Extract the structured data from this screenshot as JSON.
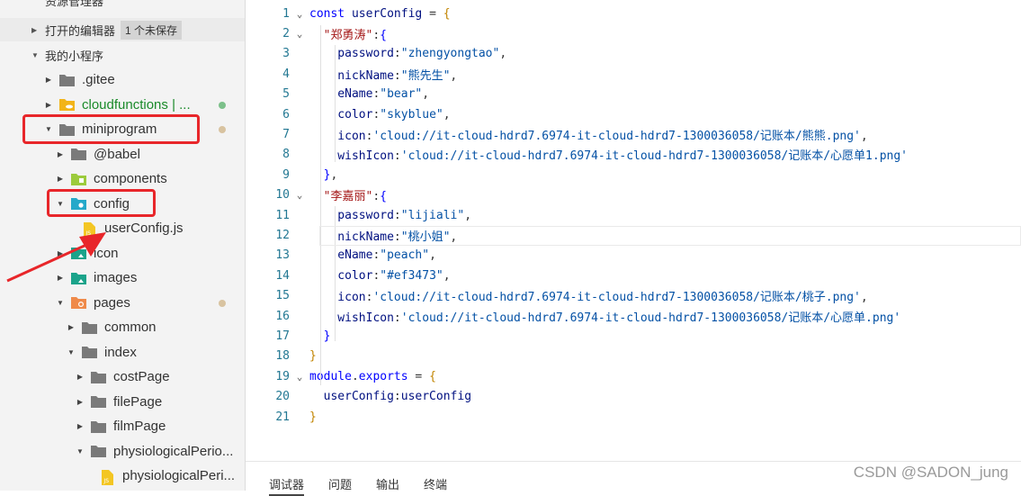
{
  "sidebar": {
    "top_cut_label": "资源管理器",
    "open_editors": {
      "label": "打开的编辑器",
      "badge": "1 个未保存"
    },
    "project": {
      "label": "我的小程序"
    },
    "tree": [
      {
        "label": ".gitee",
        "depth": 0,
        "expanded": false,
        "icon": "folder-icon",
        "color": "#7a7a7a"
      },
      {
        "label": "cloudfunctions | ...",
        "depth": 0,
        "expanded": false,
        "icon": "cloud-folder-icon",
        "color": "#f2b418",
        "text_color": "#1a8a2a",
        "dot": "#7cc08a"
      },
      {
        "label": "miniprogram",
        "depth": 0,
        "expanded": true,
        "icon": "folder-open-icon",
        "color": "#7a7a7a",
        "dot": "#d8c3a0",
        "highlight": true
      },
      {
        "label": "@babel",
        "depth": 1,
        "expanded": false,
        "icon": "folder-icon",
        "color": "#7a7a7a"
      },
      {
        "label": "components",
        "depth": 1,
        "expanded": false,
        "icon": "components-folder-icon",
        "color": "#9ccb3c"
      },
      {
        "label": "config",
        "depth": 1,
        "expanded": true,
        "icon": "config-folder-icon",
        "color": "#25a9c9",
        "highlight": true
      },
      {
        "label": "userConfig.js",
        "depth": 2,
        "file": true,
        "icon": "js-file-icon",
        "color": "#f3c623"
      },
      {
        "label": "icon",
        "depth": 1,
        "expanded": false,
        "icon": "image-folder-icon",
        "color": "#1aa38a"
      },
      {
        "label": "images",
        "depth": 1,
        "expanded": false,
        "icon": "image-folder-icon",
        "color": "#1aa38a"
      },
      {
        "label": "pages",
        "depth": 1,
        "expanded": true,
        "icon": "pages-folder-icon",
        "color": "#ef8a4a",
        "dot": "#d8c3a0"
      },
      {
        "label": "common",
        "depth": 2,
        "expanded": false,
        "icon": "folder-icon",
        "color": "#7a7a7a"
      },
      {
        "label": "index",
        "depth": 2,
        "expanded": true,
        "icon": "folder-open-icon",
        "color": "#7a7a7a"
      },
      {
        "label": "costPage",
        "depth": 3,
        "expanded": false,
        "icon": "folder-icon",
        "color": "#7a7a7a"
      },
      {
        "label": "filePage",
        "depth": 3,
        "expanded": false,
        "icon": "folder-icon",
        "color": "#7a7a7a"
      },
      {
        "label": "filmPage",
        "depth": 3,
        "expanded": false,
        "icon": "folder-icon",
        "color": "#7a7a7a"
      },
      {
        "label": "physiologicalPerio...",
        "depth": 3,
        "expanded": true,
        "icon": "folder-open-icon",
        "color": "#7a7a7a"
      },
      {
        "label": "physiologicalPeri...",
        "depth": 4,
        "file": true,
        "icon": "js-file-icon",
        "color": "#f3c623"
      }
    ]
  },
  "editor": {
    "colors": {
      "keyword": "#0000ff",
      "key": "#a31515",
      "prop": "#001080",
      "string": "#0451a5",
      "plain": "#333333",
      "brace": "#c18401"
    },
    "lines": [
      {
        "n": "1",
        "fold": "v",
        "tokens": [
          {
            "t": "const ",
            "c": "keyword"
          },
          {
            "t": "userConfig",
            "c": "prop"
          },
          {
            "t": " = ",
            "c": "plain"
          },
          {
            "t": "{",
            "c": "brace"
          }
        ]
      },
      {
        "n": "2",
        "fold": "v",
        "tokens": [
          {
            "t": "  ",
            "c": "plain"
          },
          {
            "t": "\"郑勇涛\"",
            "c": "key"
          },
          {
            "t": ":",
            "c": "plain"
          },
          {
            "t": "{",
            "c": "keyword"
          }
        ]
      },
      {
        "n": "3",
        "tokens": [
          {
            "t": "    password",
            "c": "prop"
          },
          {
            "t": ":",
            "c": "plain"
          },
          {
            "t": "\"zhengyongtao\"",
            "c": "string"
          },
          {
            "t": ",",
            "c": "plain"
          }
        ]
      },
      {
        "n": "4",
        "tokens": [
          {
            "t": "    nickName",
            "c": "prop"
          },
          {
            "t": ":",
            "c": "plain"
          },
          {
            "t": "\"熊先生\"",
            "c": "string"
          },
          {
            "t": ",",
            "c": "plain"
          }
        ]
      },
      {
        "n": "5",
        "tokens": [
          {
            "t": "    eName",
            "c": "prop"
          },
          {
            "t": ":",
            "c": "plain"
          },
          {
            "t": "\"bear\"",
            "c": "string"
          },
          {
            "t": ",",
            "c": "plain"
          }
        ]
      },
      {
        "n": "6",
        "tokens": [
          {
            "t": "    color",
            "c": "prop"
          },
          {
            "t": ":",
            "c": "plain"
          },
          {
            "t": "\"skyblue\"",
            "c": "string"
          },
          {
            "t": ",",
            "c": "plain"
          }
        ]
      },
      {
        "n": "7",
        "tokens": [
          {
            "t": "    icon",
            "c": "prop"
          },
          {
            "t": ":",
            "c": "plain"
          },
          {
            "t": "'cloud://it-cloud-hdrd7.6974-it-cloud-hdrd7-1300036058/记账本/熊熊.png'",
            "c": "string"
          },
          {
            "t": ",",
            "c": "plain"
          }
        ]
      },
      {
        "n": "8",
        "tokens": [
          {
            "t": "    wishIcon",
            "c": "prop"
          },
          {
            "t": ":",
            "c": "plain"
          },
          {
            "t": "'cloud://it-cloud-hdrd7.6974-it-cloud-hdrd7-1300036058/记账本/心愿单1.png'",
            "c": "string"
          }
        ]
      },
      {
        "n": "9",
        "tokens": [
          {
            "t": "  ",
            "c": "plain"
          },
          {
            "t": "}",
            "c": "keyword"
          },
          {
            "t": ",",
            "c": "plain"
          }
        ]
      },
      {
        "n": "10",
        "fold": "v",
        "tokens": [
          {
            "t": "  ",
            "c": "plain"
          },
          {
            "t": "\"李嘉丽\"",
            "c": "key"
          },
          {
            "t": ":",
            "c": "plain"
          },
          {
            "t": "{",
            "c": "keyword"
          }
        ]
      },
      {
        "n": "11",
        "tokens": [
          {
            "t": "    password",
            "c": "prop"
          },
          {
            "t": ":",
            "c": "plain"
          },
          {
            "t": "\"lijiali\"",
            "c": "string"
          },
          {
            "t": ",",
            "c": "plain"
          }
        ]
      },
      {
        "n": "12",
        "tokens": [
          {
            "t": "    nickName",
            "c": "prop"
          },
          {
            "t": ":",
            "c": "plain"
          },
          {
            "t": "\"桃小姐\"",
            "c": "string"
          },
          {
            "t": ",",
            "c": "plain"
          }
        ]
      },
      {
        "n": "13",
        "tokens": [
          {
            "t": "    eName",
            "c": "prop"
          },
          {
            "t": ":",
            "c": "plain"
          },
          {
            "t": "\"peach\"",
            "c": "string"
          },
          {
            "t": ",",
            "c": "plain"
          }
        ]
      },
      {
        "n": "14",
        "tokens": [
          {
            "t": "    color",
            "c": "prop"
          },
          {
            "t": ":",
            "c": "plain"
          },
          {
            "t": "\"#ef3473\"",
            "c": "string"
          },
          {
            "t": ",",
            "c": "plain"
          }
        ]
      },
      {
        "n": "15",
        "tokens": [
          {
            "t": "    icon",
            "c": "prop"
          },
          {
            "t": ":",
            "c": "plain"
          },
          {
            "t": "'cloud://it-cloud-hdrd7.6974-it-cloud-hdrd7-1300036058/记账本/桃子.png'",
            "c": "string"
          },
          {
            "t": ",",
            "c": "plain"
          }
        ]
      },
      {
        "n": "16",
        "tokens": [
          {
            "t": "    wishIcon",
            "c": "prop"
          },
          {
            "t": ":",
            "c": "plain"
          },
          {
            "t": "'cloud://it-cloud-hdrd7.6974-it-cloud-hdrd7-1300036058/记账本/心愿单.png'",
            "c": "string"
          }
        ]
      },
      {
        "n": "17",
        "tokens": [
          {
            "t": "  ",
            "c": "plain"
          },
          {
            "t": "}",
            "c": "keyword"
          }
        ]
      },
      {
        "n": "18",
        "tokens": [
          {
            "t": "}",
            "c": "brace"
          }
        ]
      },
      {
        "n": "19",
        "fold": "v",
        "tokens": [
          {
            "t": "module",
            "c": "keyword"
          },
          {
            "t": ".",
            "c": "plain"
          },
          {
            "t": "exports",
            "c": "keyword"
          },
          {
            "t": " = ",
            "c": "plain"
          },
          {
            "t": "{",
            "c": "brace"
          }
        ]
      },
      {
        "n": "20",
        "tokens": [
          {
            "t": "  userConfig",
            "c": "prop"
          },
          {
            "t": ":",
            "c": "plain"
          },
          {
            "t": "userConfig",
            "c": "prop"
          }
        ]
      },
      {
        "n": "21",
        "tokens": [
          {
            "t": "}",
            "c": "brace"
          }
        ]
      }
    ]
  },
  "bottom_panel": {
    "tabs": [
      "调试器",
      "问题",
      "输出",
      "终端"
    ]
  },
  "watermark": "CSDN @SADON_jung",
  "annotation_color": "#e8262a"
}
